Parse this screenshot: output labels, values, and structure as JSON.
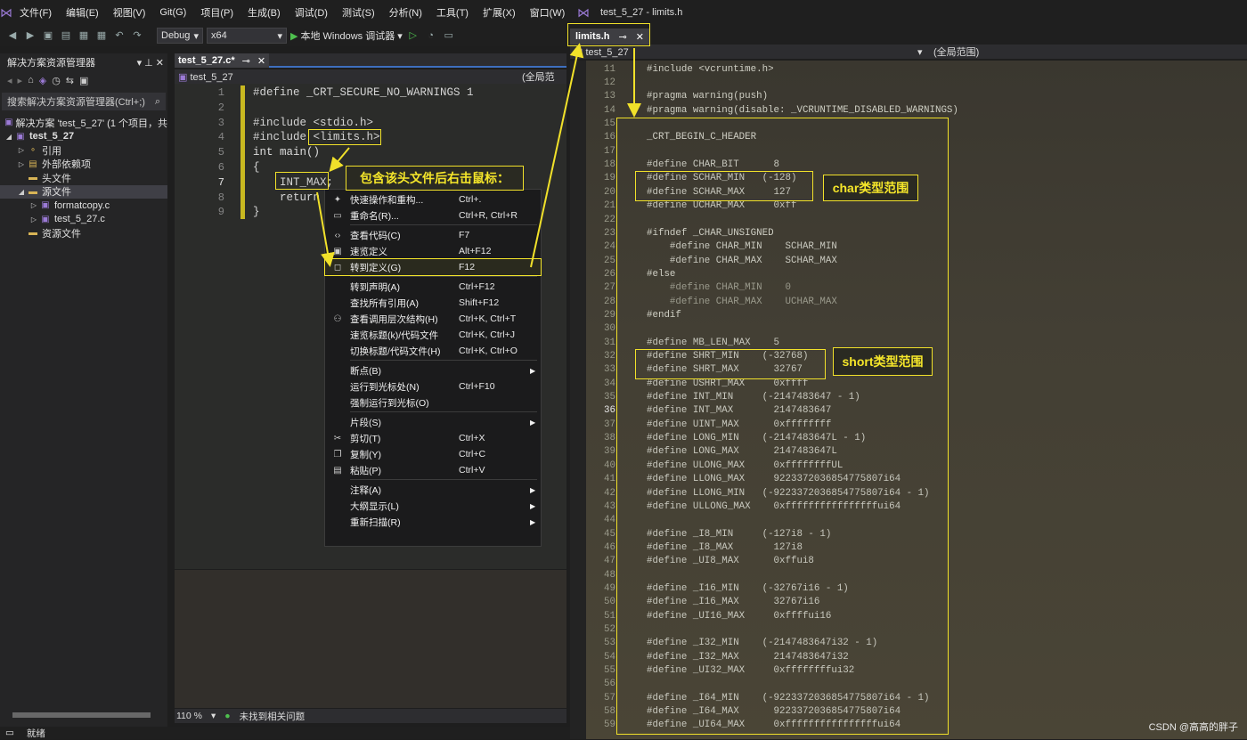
{
  "menubar": {
    "items": [
      "文件(F)",
      "编辑(E)",
      "视图(V)",
      "Git(G)",
      "项目(P)",
      "生成(B)",
      "调试(D)",
      "测试(S)",
      "分析(N)",
      "工具(T)",
      "扩展(X)",
      "窗口(W)",
      "帮"
    ]
  },
  "toolbar": {
    "config": "Debug",
    "platform": "x64",
    "run_label": "本地 Windows 调试器"
  },
  "solution_explorer": {
    "title": "解决方案资源管理器",
    "search_placeholder": "搜索解决方案资源管理器(Ctrl+;)",
    "items": [
      {
        "label": "解决方案 'test_5_27' (1 个项目，共",
        "level": 0,
        "bold": false
      },
      {
        "label": "test_5_27",
        "level": 0,
        "bold": true
      },
      {
        "label": "引用",
        "level": 1,
        "bold": false
      },
      {
        "label": "外部依赖项",
        "level": 1,
        "bold": false
      },
      {
        "label": "头文件",
        "level": 1,
        "bold": false
      },
      {
        "label": "源文件",
        "level": 1,
        "bold": false
      },
      {
        "label": "formatcopy.c",
        "level": 2,
        "bold": false
      },
      {
        "label": "test_5_27.c",
        "level": 2,
        "bold": false
      },
      {
        "label": "资源文件",
        "level": 1,
        "bold": false
      }
    ]
  },
  "left_editor": {
    "tab": "test_5_27.c*",
    "nav_project": "test_5_27",
    "nav_scope": "(全局范",
    "lines": [
      {
        "n": "1",
        "code": "#define _CRT_SECURE_NO_WARNINGS 1"
      },
      {
        "n": "2",
        "code": ""
      },
      {
        "n": "3",
        "code": "#include <stdio.h>"
      },
      {
        "n": "4",
        "code": "#include <limits.h>"
      },
      {
        "n": "5",
        "code": "int main()"
      },
      {
        "n": "6",
        "code": "{"
      },
      {
        "n": "7",
        "code": "    INT_MAX;"
      },
      {
        "n": "8",
        "code": "    return"
      },
      {
        "n": "9",
        "code": "}"
      }
    ],
    "zoom": "110 %",
    "issues": "未找到相关问题"
  },
  "statusbar": {
    "text": "就绪"
  },
  "context_menu": {
    "items": [
      {
        "label": "快速操作和重构...",
        "shortcut": "Ctrl+.",
        "icon": "lightbulb-icon"
      },
      {
        "label": "重命名(R)...",
        "shortcut": "Ctrl+R, Ctrl+R",
        "icon": "rename-icon"
      },
      {
        "label": "查看代码(C)",
        "shortcut": "F7",
        "icon": "code-icon"
      },
      {
        "label": "速览定义",
        "shortcut": "Alt+F12",
        "icon": "peek-icon"
      },
      {
        "label": "转到定义(G)",
        "shortcut": "F12",
        "icon": "goto-icon",
        "highlighted": true
      },
      {
        "label": "转到声明(A)",
        "shortcut": "Ctrl+F12",
        "icon": ""
      },
      {
        "label": "查找所有引用(A)",
        "shortcut": "Shift+F12",
        "icon": ""
      },
      {
        "label": "查看调用层次结构(H)",
        "shortcut": "Ctrl+K, Ctrl+T",
        "icon": "hierarchy-icon"
      },
      {
        "label": "速览标题(k)/代码文件",
        "shortcut": "Ctrl+K, Ctrl+J",
        "icon": ""
      },
      {
        "label": "切换标题/代码文件(H)",
        "shortcut": "Ctrl+K, Ctrl+O",
        "icon": ""
      },
      {
        "label": "断点(B)",
        "shortcut": "",
        "icon": "",
        "submenu": true
      },
      {
        "label": "运行到光标处(N)",
        "shortcut": "Ctrl+F10",
        "icon": ""
      },
      {
        "label": "强制运行到光标(O)",
        "shortcut": "",
        "icon": ""
      },
      {
        "label": "片段(S)",
        "shortcut": "",
        "icon": "",
        "submenu": true
      },
      {
        "label": "剪切(T)",
        "shortcut": "Ctrl+X",
        "icon": "cut-icon"
      },
      {
        "label": "复制(Y)",
        "shortcut": "Ctrl+C",
        "icon": "copy-icon"
      },
      {
        "label": "粘贴(P)",
        "shortcut": "Ctrl+V",
        "icon": "paste-icon"
      },
      {
        "label": "注释(A)",
        "shortcut": "",
        "icon": "",
        "submenu": true
      },
      {
        "label": "大纲显示(L)",
        "shortcut": "",
        "icon": "",
        "submenu": true
      },
      {
        "label": "重新扫描(R)",
        "shortcut": "",
        "icon": "",
        "submenu": true
      }
    ]
  },
  "right_window": {
    "title": "test_5_27 - limits.h",
    "tab": "limits.h",
    "nav_project": "test_5_27",
    "nav_scope": "(全局范围)",
    "lines": [
      [
        "11",
        "#include <vcruntime.h>"
      ],
      [
        "12",
        ""
      ],
      [
        "13",
        "#pragma warning(push)"
      ],
      [
        "14",
        "#pragma warning(disable: _VCRUNTIME_DISABLED_WARNINGS)"
      ],
      [
        "15",
        ""
      ],
      [
        "16",
        "_CRT_BEGIN_C_HEADER"
      ],
      [
        "17",
        ""
      ],
      [
        "18",
        "#define CHAR_BIT      8"
      ],
      [
        "19",
        "#define SCHAR_MIN   (-128)"
      ],
      [
        "20",
        "#define SCHAR_MAX     127"
      ],
      [
        "21",
        "#define UCHAR_MAX     0xff"
      ],
      [
        "22",
        ""
      ],
      [
        "23",
        "#ifndef _CHAR_UNSIGNED"
      ],
      [
        "24",
        "    #define CHAR_MIN    SCHAR_MIN"
      ],
      [
        "25",
        "    #define CHAR_MAX    SCHAR_MAX"
      ],
      [
        "26",
        "#else"
      ],
      [
        "27",
        "    #define CHAR_MIN    0"
      ],
      [
        "28",
        "    #define CHAR_MAX    UCHAR_MAX"
      ],
      [
        "29",
        "#endif"
      ],
      [
        "30",
        ""
      ],
      [
        "31",
        "#define MB_LEN_MAX    5"
      ],
      [
        "32",
        "#define SHRT_MIN    (-32768)"
      ],
      [
        "33",
        "#define SHRT_MAX      32767"
      ],
      [
        "34",
        "#define USHRT_MAX     0xffff"
      ],
      [
        "35",
        "#define INT_MIN     (-2147483647 - 1)"
      ],
      [
        "36",
        "#define INT_MAX       2147483647"
      ],
      [
        "37",
        "#define UINT_MAX      0xffffffff"
      ],
      [
        "38",
        "#define LONG_MIN    (-2147483647L - 1)"
      ],
      [
        "39",
        "#define LONG_MAX      2147483647L"
      ],
      [
        "40",
        "#define ULONG_MAX     0xffffffffUL"
      ],
      [
        "41",
        "#define LLONG_MAX     9223372036854775807i64"
      ],
      [
        "42",
        "#define LLONG_MIN   (-9223372036854775807i64 - 1)"
      ],
      [
        "43",
        "#define ULLONG_MAX    0xffffffffffffffffui64"
      ],
      [
        "44",
        ""
      ],
      [
        "45",
        "#define _I8_MIN     (-127i8 - 1)"
      ],
      [
        "46",
        "#define _I8_MAX       127i8"
      ],
      [
        "47",
        "#define _UI8_MAX      0xffui8"
      ],
      [
        "48",
        ""
      ],
      [
        "49",
        "#define _I16_MIN    (-32767i16 - 1)"
      ],
      [
        "50",
        "#define _I16_MAX      32767i16"
      ],
      [
        "51",
        "#define _UI16_MAX     0xffffui16"
      ],
      [
        "52",
        ""
      ],
      [
        "53",
        "#define _I32_MIN    (-2147483647i32 - 1)"
      ],
      [
        "54",
        "#define _I32_MAX      2147483647i32"
      ],
      [
        "55",
        "#define _UI32_MAX     0xffffffffui32"
      ],
      [
        "56",
        ""
      ],
      [
        "57",
        "#define _I64_MIN    (-9223372036854775807i64 - 1)"
      ],
      [
        "58",
        "#define _I64_MAX      9223372036854775807i64"
      ],
      [
        "59",
        "#define _UI64_MAX     0xffffffffffffffffui64"
      ]
    ],
    "current_line": "36"
  },
  "annotations": {
    "right_click": "包含该头文件后右击鼠标：",
    "char_range": "char类型范围",
    "short_range": "short类型范围"
  },
  "watermark": "CSDN @高高的胖子",
  "colors": {
    "accent": "#f1e12a",
    "selection": "#3f3f46",
    "tab_underline": "#3e6fbf"
  }
}
